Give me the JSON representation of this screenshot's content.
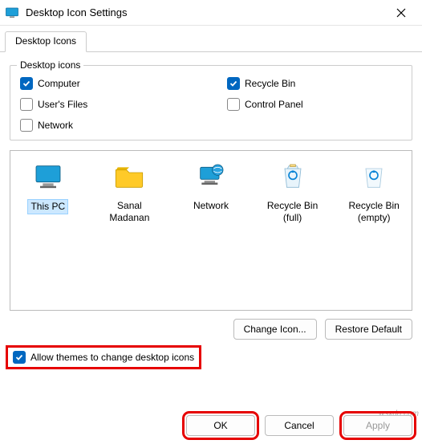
{
  "window": {
    "title": "Desktop Icon Settings"
  },
  "tabs": [
    {
      "label": "Desktop Icons"
    }
  ],
  "group": {
    "legend": "Desktop icons",
    "checks": [
      {
        "label": "Computer",
        "checked": true
      },
      {
        "label": "Recycle Bin",
        "checked": true
      },
      {
        "label": "User's Files",
        "checked": false
      },
      {
        "label": "Control Panel",
        "checked": false
      },
      {
        "label": "Network",
        "checked": false
      }
    ]
  },
  "icons": [
    {
      "name": "this-pc",
      "label": "This PC",
      "selected": true
    },
    {
      "name": "user-folder",
      "label": "Sanal Madanan",
      "selected": false
    },
    {
      "name": "network",
      "label": "Network",
      "selected": false
    },
    {
      "name": "recycle-bin-full",
      "label": "Recycle Bin (full)",
      "selected": false
    },
    {
      "name": "recycle-bin-empty",
      "label": "Recycle Bin (empty)",
      "selected": false
    }
  ],
  "buttons": {
    "change_icon": "Change Icon...",
    "restore_default": "Restore Default",
    "ok": "OK",
    "cancel": "Cancel",
    "apply": "Apply"
  },
  "allow_themes": {
    "label": "Allow themes to change desktop icons",
    "checked": true
  },
  "watermark": "wsxdn.com"
}
